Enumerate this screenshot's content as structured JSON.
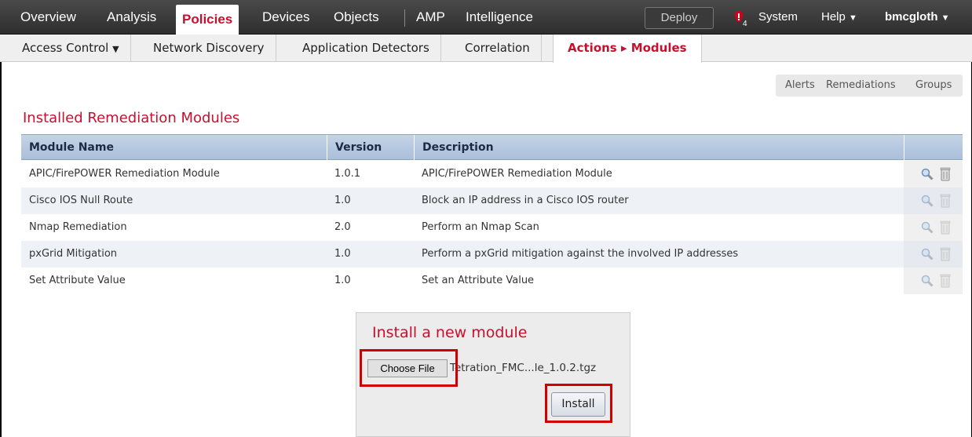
{
  "topnav": {
    "items": [
      "Overview",
      "Analysis",
      "Policies",
      "Devices",
      "Objects",
      "AMP",
      "Intelligence"
    ],
    "deploy_label": "Deploy",
    "alert_count": "4",
    "system_label": "System",
    "help_label": "Help",
    "user_label": "bmcgloth"
  },
  "subnav": {
    "items": [
      "Access Control",
      "Network Discovery",
      "Application Detectors",
      "Correlation",
      "Actions ▸ Modules"
    ]
  },
  "right_links": [
    "Alerts",
    "Remediations",
    "Groups"
  ],
  "section_title": "Installed Remediation Modules",
  "table": {
    "headers": [
      "Module Name",
      "Version",
      "Description"
    ],
    "rows": [
      {
        "name": "APIC/FirePOWER Remediation Module",
        "version": "1.0.1",
        "description": "APIC/FirePOWER Remediation Module"
      },
      {
        "name": "Cisco IOS Null Route",
        "version": "1.0",
        "description": "Block an IP address in a Cisco IOS router"
      },
      {
        "name": "Nmap Remediation",
        "version": "2.0",
        "description": "Perform an Nmap Scan"
      },
      {
        "name": "pxGrid Mitigation",
        "version": "1.0",
        "description": "Perform a pxGrid mitigation against the involved IP addresses"
      },
      {
        "name": "Set Attribute Value",
        "version": "1.0",
        "description": "Set an Attribute Value"
      }
    ]
  },
  "install": {
    "title": "Install a new module",
    "choose_label": "Choose File",
    "file_name": "Tetration_FMC...le_1.0.2.tgz",
    "install_label": "Install"
  },
  "colors": {
    "accent": "#c8102e",
    "highlight": "#d10000",
    "header_blue": "#a9bfdb"
  }
}
